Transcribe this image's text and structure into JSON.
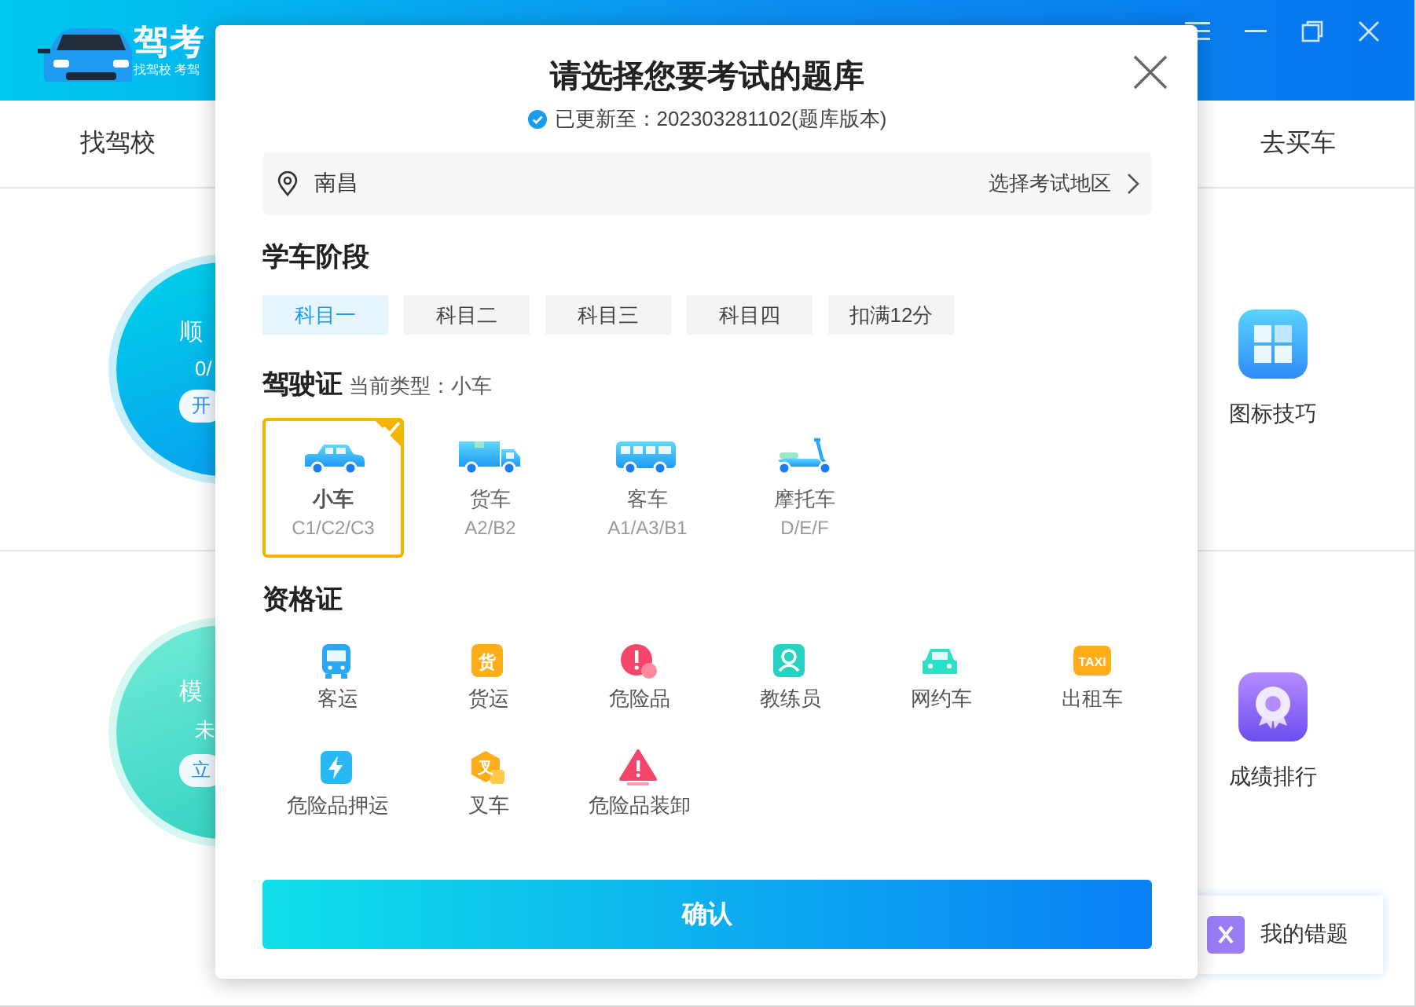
{
  "app": {
    "logo_title": "驾考",
    "logo_subtitle": "找驾校 考驾",
    "nav_left": "找驾校",
    "nav_right": "去买车",
    "practice_cards": [
      {
        "kind": "order",
        "title": "顺",
        "count": "0/",
        "button": "开"
      },
      {
        "kind": "exam",
        "title": "模",
        "count": "未",
        "button": "立"
      }
    ],
    "tools": [
      {
        "kind": "tips",
        "label": "图标技巧"
      },
      {
        "kind": "rank",
        "label": "成绩排行"
      }
    ],
    "mistakes": {
      "label": "我的错题"
    }
  },
  "dialog": {
    "title": "请选择您要考试的题库",
    "update": "已更新至：202303281102(题库版本)",
    "location": {
      "city": "南昌",
      "action": "选择考试地区"
    },
    "stage": {
      "heading": "学车阶段",
      "tabs": [
        {
          "label": "科目一",
          "selected": true
        },
        {
          "label": "科目二",
          "selected": false
        },
        {
          "label": "科目三",
          "selected": false
        },
        {
          "label": "科目四",
          "selected": false
        },
        {
          "label": "扣满12分",
          "selected": false
        }
      ]
    },
    "license": {
      "heading": "驾驶证",
      "current": "当前类型：小车",
      "types": [
        {
          "kind": "car",
          "name": "小车",
          "classes": "C1/C2/C3",
          "selected": true
        },
        {
          "kind": "truck",
          "name": "货车",
          "classes": "A2/B2",
          "selected": false
        },
        {
          "kind": "bus",
          "name": "客车",
          "classes": "A1/A3/B1",
          "selected": false
        },
        {
          "kind": "moto",
          "name": "摩托车",
          "classes": "D/E/F",
          "selected": false
        }
      ]
    },
    "qualification": {
      "heading": "资格证",
      "items": [
        {
          "kind": "bus",
          "label": "客运"
        },
        {
          "kind": "cargo",
          "label": "货运",
          "icon_text": "货"
        },
        {
          "kind": "danger",
          "label": "危险品"
        },
        {
          "kind": "coach",
          "label": "教练员"
        },
        {
          "kind": "ridehail",
          "label": "网约车"
        },
        {
          "kind": "taxi",
          "label": "出租车",
          "icon_text": "TAXI"
        },
        {
          "kind": "escort",
          "label": "危险品押运"
        },
        {
          "kind": "forklift",
          "label": "叉车",
          "icon_text": "叉"
        },
        {
          "kind": "warning",
          "label": "危险品装卸"
        }
      ]
    },
    "confirm": "确认"
  }
}
